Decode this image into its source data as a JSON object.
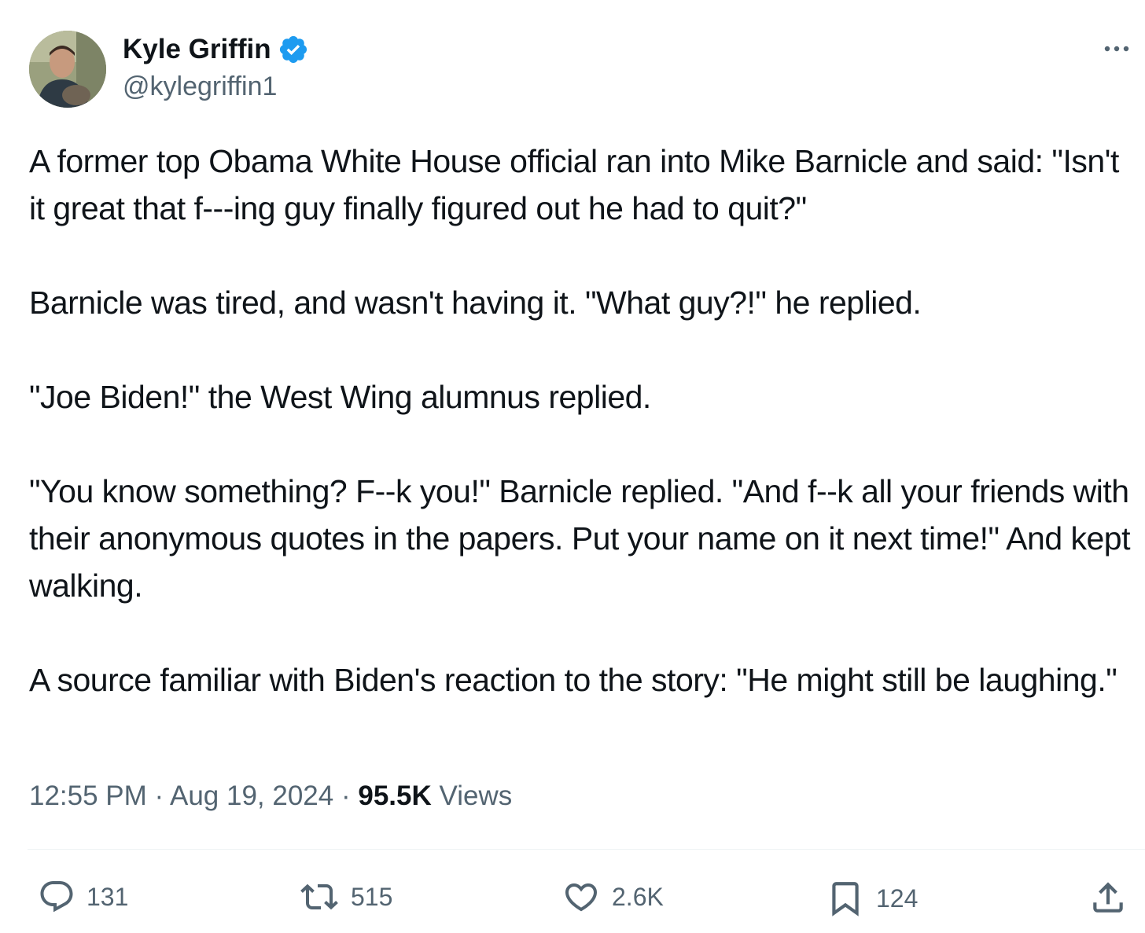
{
  "author": {
    "display_name": "Kyle Griffin",
    "handle": "@kylegriffin1",
    "verified_icon": "verified-badge-icon",
    "verified_color": "#1d9bf0"
  },
  "tweet": {
    "paragraphs": [
      "A former top Obama White House official ran into Mike Barnicle and said: \"Isn't it great that f---ing guy finally figured out he had to quit?\"",
      "Barnicle was tired, and wasn't having it. \"What guy?!\" he replied.",
      "\"Joe Biden!\" the West Wing alumnus replied.",
      "\"You know something? F--k you!\" Barnicle replied. \"And f--k all your friends with their anonymous quotes in the papers. Put your name on it next time!\" And kept walking.",
      "A source familiar with Biden's reaction to the story: \"He might still be laughing.\""
    ]
  },
  "meta": {
    "time": "12:55 PM",
    "separator": " · ",
    "date": "Aug 19, 2024",
    "views_count": "95.5K",
    "views_label": " Views"
  },
  "actions": {
    "replies": {
      "icon": "reply-icon",
      "count": "131"
    },
    "reposts": {
      "icon": "repost-icon",
      "count": "515"
    },
    "likes": {
      "icon": "heart-icon",
      "count": "2.6K"
    },
    "bookmarks": {
      "icon": "bookmark-icon",
      "count": "124"
    },
    "share": {
      "icon": "share-icon"
    }
  },
  "colors": {
    "text_primary": "#0f1419",
    "text_secondary": "#536471",
    "divider": "#eff3f4",
    "accent": "#1d9bf0"
  }
}
